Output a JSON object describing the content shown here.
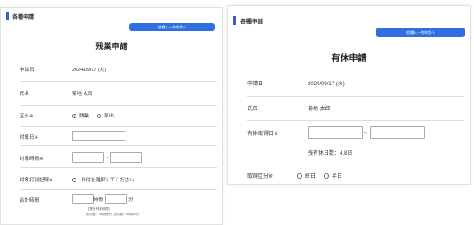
{
  "left": {
    "header": "各種申請",
    "button": "他種入一時申請へ",
    "title": "残業申請",
    "application_date_label": "申請日",
    "application_date_value": "2024/09/17 (火)",
    "name_label": "氏名",
    "name_value": "菊地 太郎",
    "category_label": "区分※",
    "category_options": [
      "残業",
      "早出"
    ],
    "target_date_label": "対象日※",
    "target_time_label": "対象時間※",
    "time_separator": "〜",
    "target_stamp_label": "対象打刻記録※",
    "target_stamp_hint": "日付を選択してください",
    "total_time_label": "合計時間",
    "hour_unit": "時間",
    "minute_unit": "分",
    "note_line1": "【累計残業時間】",
    "note_line2": "前月度：0時間0分   当月度：0時間0分"
  },
  "right": {
    "header": "各種申請",
    "button": "他種入一時申請へ",
    "title": "有休申請",
    "application_date_label": "申請日",
    "application_date_value": "2024/09/17 (火)",
    "name_label": "氏名",
    "name_value": "菊地 太郎",
    "period_label": "有休取得日※",
    "period_separator": "〜",
    "remaining_days": "残有休日数：4.8日",
    "category_label": "取得区分※",
    "category_options": [
      "終日",
      "半日"
    ]
  }
}
